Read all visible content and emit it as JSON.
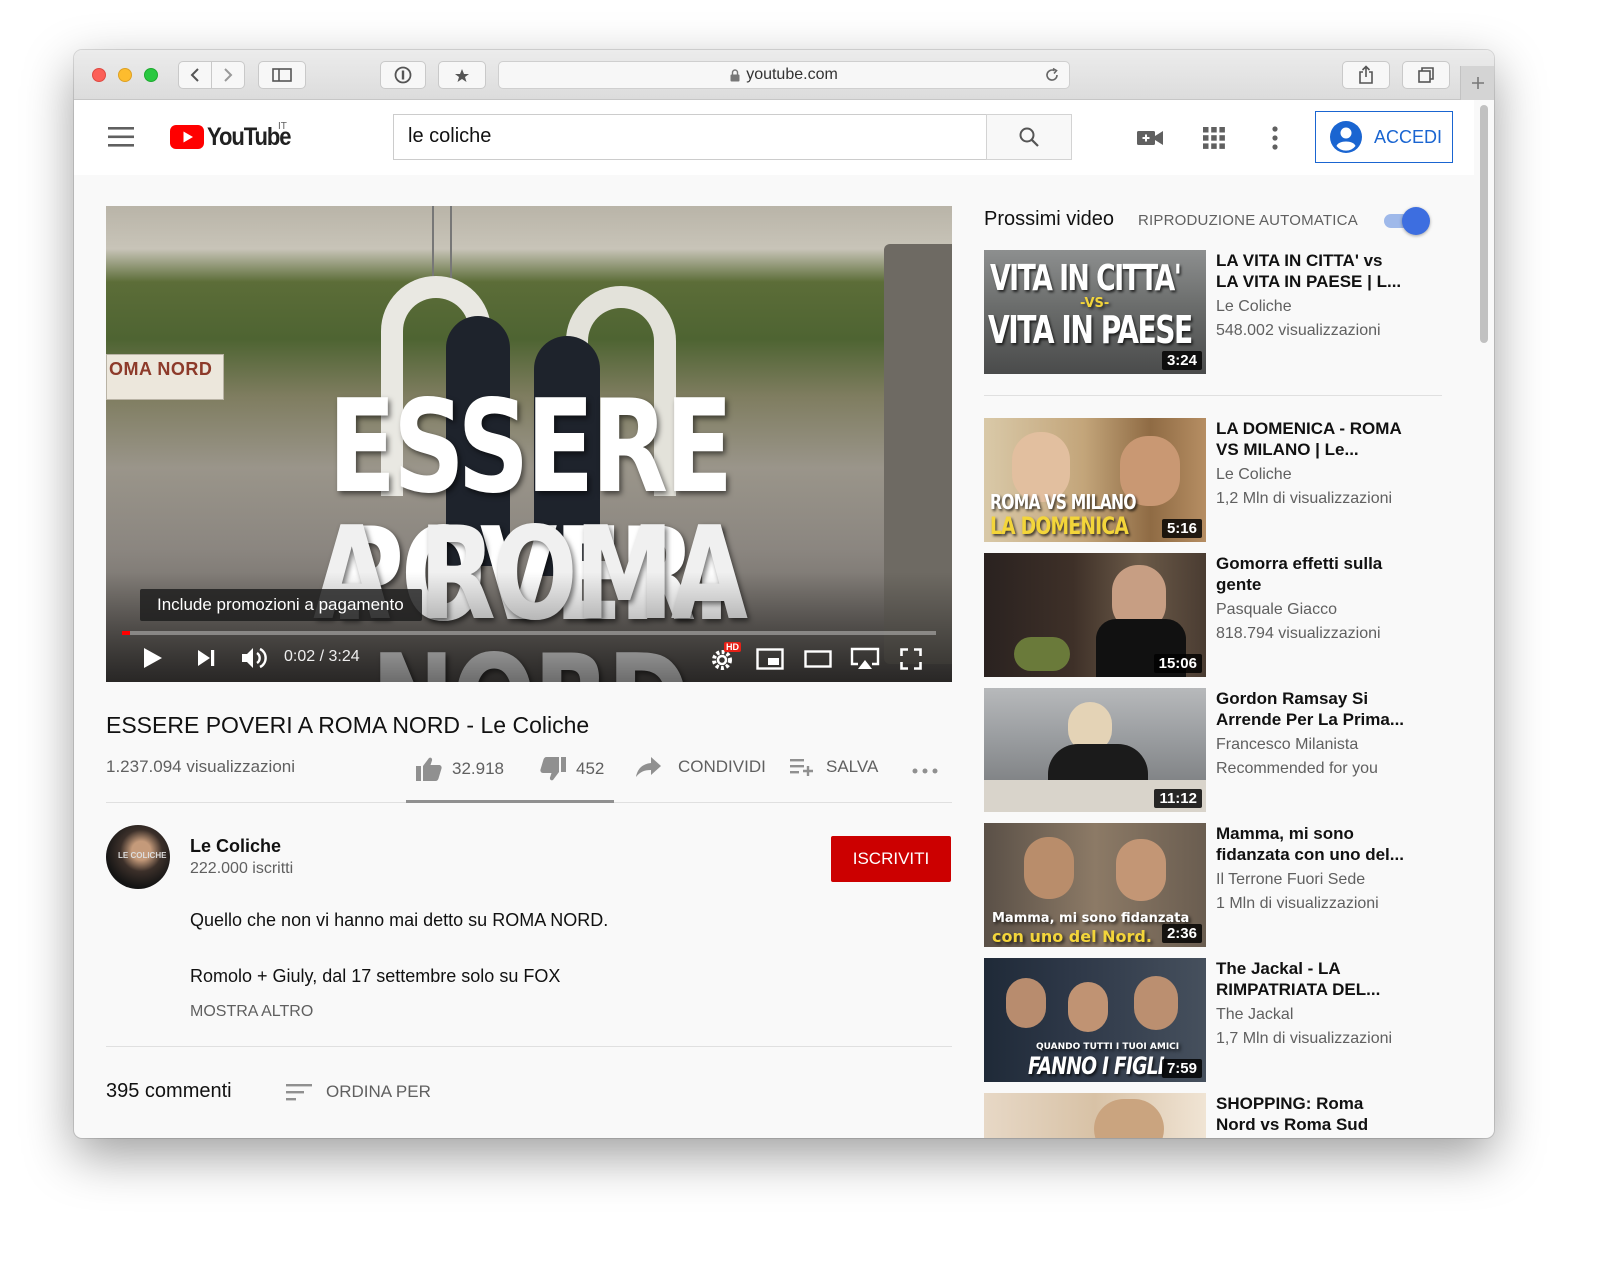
{
  "browser": {
    "url": "youtube.com"
  },
  "header": {
    "logo_text": "YouTube",
    "region": "IT",
    "search_value": "le coliche",
    "signin_label": "ACCEDI"
  },
  "player": {
    "overlay_line1": "ESSERE POVERI",
    "overlay_line2": "A ROMA NORD",
    "sign_text": "OMA NORD",
    "promo_label": "Include promozioni a pagamento",
    "time": "0:02 / 3:24",
    "hd_badge": "HD",
    "progress_fraction": 0.01
  },
  "video": {
    "title": "ESSERE POVERI A ROMA NORD - Le Coliche",
    "views": "1.237.094 visualizzazioni",
    "likes": "32.918",
    "dislikes": "452",
    "share_label": "CONDIVIDI",
    "save_label": "SALVA",
    "like_ratio": 0.986
  },
  "channel": {
    "avatar_text": "LE COLICHE",
    "name": "Le Coliche",
    "subscribers": "222.000 iscritti",
    "subscribe_label": "ISCRIVITI"
  },
  "description": {
    "line1": "Quello che non vi hanno mai detto su ROMA NORD.",
    "line2": "Romolo + Giuly, dal 17 settembre solo su FOX",
    "show_more": "MOSTRA ALTRO"
  },
  "comments": {
    "count": "395 commenti",
    "sort_label": "ORDINA PER"
  },
  "sidebar": {
    "next_label": "Prossimi video",
    "autoplay_label": "RIPRODUZIONE AUTOMATICA",
    "autoplay_on": true,
    "items": [
      {
        "title_line1": "LA VITA IN CITTA' vs",
        "title_line2": "LA VITA IN PAESE | L...",
        "channel": "Le Coliche",
        "views": "548.002 visualizzazioni",
        "duration": "3:24",
        "thumb_line1": "VITA IN CITTA'",
        "thumb_mid": "-VS-",
        "thumb_line2": "VITA IN PAESE"
      },
      {
        "title_line1": "LA DOMENICA - ROMA",
        "title_line2": "VS MILANO | Le...",
        "channel": "Le Coliche",
        "views": "1,2 Mln di visualizzazioni",
        "duration": "5:16",
        "thumb_line1": "ROMA VS MILANO",
        "thumb_line2": "LA DOMENICA"
      },
      {
        "title_line1": "Gomorra effetti sulla",
        "title_line2": "gente",
        "channel": "Pasquale Giacco",
        "views": "818.794 visualizzazioni",
        "duration": "15:06"
      },
      {
        "title_line1": "Gordon Ramsay Si",
        "title_line2": "Arrende Per La Prima...",
        "channel": "Francesco Milanista",
        "views": "Recommended for you",
        "duration": "11:12"
      },
      {
        "title_line1": "Mamma, mi sono",
        "title_line2": "fidanzata con uno del...",
        "channel": "Il Terrone Fuori Sede",
        "views": "1 Mln di visualizzazioni",
        "duration": "2:36",
        "thumb_line1": "Mamma, mi sono fidanzata",
        "thumb_line2": "con uno del Nord."
      },
      {
        "title_line1": "The Jackal - LA",
        "title_line2": "RIMPATRIATA DEL...",
        "channel": "The Jackal",
        "views": "1,7 Mln di visualizzazioni",
        "duration": "7:59",
        "thumb_line1": "QUANDO TUTTI I TUOI AMICI",
        "thumb_line2": "FANNO I FIGLI"
      },
      {
        "title_line1": "SHOPPING: Roma",
        "title_line2": "Nord vs Roma Sud"
      }
    ]
  },
  "colors": {
    "brand_red": "#ff0000",
    "subscribe_red": "#cc0000",
    "signin_blue": "#1a65d1",
    "toggle_blue": "#3d6ee0"
  },
  "icons": [
    "back-icon",
    "forward-icon",
    "sidebar-icon",
    "password-icon",
    "bookmark-icon",
    "lock-icon",
    "reload-icon",
    "share-icon",
    "tabs-icon",
    "plus-icon",
    "menu-icon",
    "youtube-play-icon",
    "search-icon",
    "camera-icon",
    "apps-grid-icon",
    "more-vert-icon",
    "account-icon",
    "play-icon",
    "next-icon",
    "volume-icon",
    "settings-icon",
    "miniplayer-icon",
    "theater-icon",
    "airplay-icon",
    "fullscreen-icon",
    "thumb-up-icon",
    "thumb-down-icon",
    "share-arrow-icon",
    "playlist-add-icon",
    "more-horiz-icon",
    "sort-icon"
  ]
}
